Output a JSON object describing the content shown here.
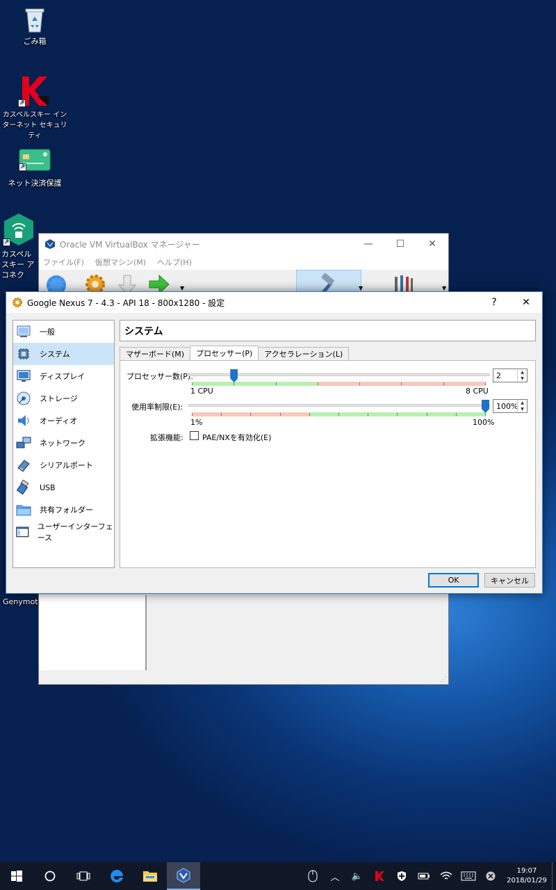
{
  "desktop": {
    "icons": [
      {
        "label": "ごみ箱"
      },
      {
        "label": "カスペルスキー インターネット セキュリティ"
      },
      {
        "label": "ネット決済保護"
      },
      {
        "label": "カスペルスキー アコネク"
      },
      {
        "label": "Genymoti"
      }
    ]
  },
  "manager": {
    "title": "Oracle VM VirtualBox マネージャー",
    "menu": [
      "ファイル(F)",
      "仮想マシン(M)",
      "ヘルプ(H)"
    ]
  },
  "dialog": {
    "title": "Google Nexus 7 - 4.3 - API 18 - 800x1280 - 設定",
    "help": "?",
    "close": "✕",
    "nav": [
      {
        "label": "一般",
        "icon": "general-icon"
      },
      {
        "label": "システム",
        "icon": "system-icon"
      },
      {
        "label": "ディスプレイ",
        "icon": "display-icon"
      },
      {
        "label": "ストレージ",
        "icon": "storage-icon"
      },
      {
        "label": "オーディオ",
        "icon": "audio-icon"
      },
      {
        "label": "ネットワーク",
        "icon": "network-icon"
      },
      {
        "label": "シリアルポート",
        "icon": "serial-port-icon"
      },
      {
        "label": "USB",
        "icon": "usb-icon"
      },
      {
        "label": "共有フォルダー",
        "icon": "shared-folder-icon"
      },
      {
        "label": "ユーザーインターフェース",
        "icon": "user-interface-icon"
      }
    ],
    "selected_nav": 1,
    "section_title": "システム",
    "tabs": [
      "マザーボード(M)",
      "プロセッサー(P)",
      "アクセラレーション(L)"
    ],
    "selected_tab": 1,
    "processor": {
      "label": "プロセッサー数(P):",
      "value": "2",
      "min_label": "1 CPU",
      "max_label": "8 CPU",
      "level": 2,
      "min": 1,
      "max": 8
    },
    "cap": {
      "label": "使用率制限(E):",
      "value": "100%",
      "min_label": "1%",
      "max_label": "100%",
      "level": 100
    },
    "extended": {
      "label": "拡張機能:",
      "pae_label": "PAE/NXを有効化(E)",
      "pae_checked": false
    },
    "ok": "OK",
    "cancel": "キャンセル"
  },
  "taskbar": {
    "time": "19:07",
    "date": "2018/01/29"
  },
  "colors": {
    "accent": "#0078d7",
    "slider_thumb": "#1e73c8",
    "band_green": "#b8f0b0",
    "band_red": "#f8c8b8",
    "selection": "#cce4f7"
  }
}
